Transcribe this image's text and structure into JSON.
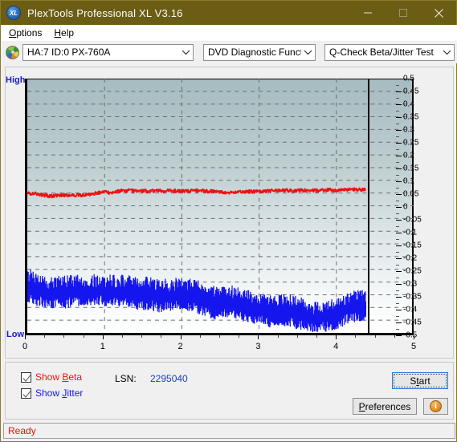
{
  "window": {
    "title": "PlexTools Professional XL V3.16",
    "icon": "XL",
    "icon_name": "plextools-logo-icon",
    "controls": {
      "minimize": "minimize-icon",
      "maximize": "maximize-icon",
      "close": "close-icon"
    },
    "titlebar_color": "#6b5d14"
  },
  "menu": {
    "items": [
      {
        "label": "Options",
        "accel": "O"
      },
      {
        "label": "Help",
        "accel": "H"
      }
    ]
  },
  "toolbar": {
    "disc_icon": "disc-icon",
    "drive": {
      "value": "HA:7 ID:0  PX-760A",
      "arrow": "chevron-down-icon"
    },
    "function": {
      "value": "DVD Diagnostic Functions",
      "arrow": "chevron-down-icon"
    },
    "test": {
      "value": "Q-Check Beta/Jitter Test",
      "arrow": "chevron-down-icon"
    }
  },
  "chart_data": {
    "type": "line",
    "title": "",
    "xlabel": "",
    "ylabel": "",
    "xlim": [
      0,
      5
    ],
    "ylim": [
      -0.5,
      0.5
    ],
    "grid": true,
    "legend": "checkboxes below plot",
    "axis_left_label": "High",
    "axis_bottom_label": "Low",
    "x_ticks": [
      0,
      1,
      2,
      3,
      4,
      5
    ],
    "y_ticks": [
      0.5,
      0.45,
      0.4,
      0.35,
      0.3,
      0.25,
      0.2,
      0.15,
      0.1,
      0.05,
      0,
      -0.05,
      -0.1,
      -0.15,
      -0.2,
      -0.25,
      -0.3,
      -0.35,
      -0.4,
      -0.45,
      -0.5
    ],
    "cursor_x": 4.38,
    "data_end_x": 4.38,
    "series": [
      {
        "name": "Beta",
        "color": "#ee1111",
        "noise": 0.006,
        "x": [
          0.0,
          0.1,
          0.2,
          0.3,
          0.4,
          0.5,
          0.6,
          0.7,
          0.8,
          0.9,
          1.0,
          1.1,
          1.2,
          1.3,
          1.4,
          1.5,
          1.6,
          1.7,
          1.8,
          1.9,
          2.0,
          2.1,
          2.2,
          2.3,
          2.4,
          2.5,
          2.6,
          2.7,
          2.8,
          2.9,
          3.0,
          3.1,
          3.2,
          3.3,
          3.4,
          3.5,
          3.6,
          3.7,
          3.8,
          3.9,
          4.0,
          4.1,
          4.2,
          4.3,
          4.38
        ],
        "y": [
          0.05,
          0.047,
          0.043,
          0.038,
          0.04,
          0.043,
          0.042,
          0.041,
          0.044,
          0.05,
          0.053,
          0.052,
          0.058,
          0.06,
          0.059,
          0.058,
          0.058,
          0.058,
          0.058,
          0.059,
          0.058,
          0.059,
          0.06,
          0.058,
          0.056,
          0.054,
          0.053,
          0.054,
          0.056,
          0.056,
          0.057,
          0.058,
          0.06,
          0.06,
          0.06,
          0.061,
          0.06,
          0.06,
          0.06,
          0.062,
          0.061,
          0.062,
          0.064,
          0.064,
          0.063
        ]
      },
      {
        "name": "Jitter",
        "color": "#1515ee",
        "band": true,
        "x": [
          0.0,
          0.1,
          0.2,
          0.3,
          0.4,
          0.5,
          0.6,
          0.7,
          0.8,
          0.9,
          1.0,
          1.1,
          1.2,
          1.3,
          1.4,
          1.5,
          1.6,
          1.7,
          1.8,
          1.9,
          2.0,
          2.1,
          2.2,
          2.3,
          2.4,
          2.5,
          2.6,
          2.7,
          2.8,
          2.9,
          3.0,
          3.1,
          3.2,
          3.3,
          3.4,
          3.5,
          3.6,
          3.7,
          3.8,
          3.9,
          4.0,
          4.1,
          4.2,
          4.3,
          4.38
        ],
        "y_top": [
          -0.27,
          -0.295,
          -0.305,
          -0.3,
          -0.305,
          -0.3,
          -0.302,
          -0.3,
          -0.298,
          -0.3,
          -0.302,
          -0.3,
          -0.302,
          -0.3,
          -0.305,
          -0.308,
          -0.31,
          -0.32,
          -0.315,
          -0.312,
          -0.31,
          -0.315,
          -0.322,
          -0.33,
          -0.345,
          -0.342,
          -0.34,
          -0.345,
          -0.355,
          -0.36,
          -0.368,
          -0.375,
          -0.378,
          -0.374,
          -0.378,
          -0.385,
          -0.398,
          -0.405,
          -0.405,
          -0.4,
          -0.392,
          -0.378,
          -0.365,
          -0.358,
          -0.362
        ],
        "y_bottom": [
          -0.355,
          -0.37,
          -0.38,
          -0.385,
          -0.38,
          -0.382,
          -0.378,
          -0.376,
          -0.37,
          -0.372,
          -0.375,
          -0.372,
          -0.376,
          -0.378,
          -0.386,
          -0.39,
          -0.392,
          -0.398,
          -0.392,
          -0.39,
          -0.388,
          -0.394,
          -0.402,
          -0.412,
          -0.426,
          -0.424,
          -0.42,
          -0.426,
          -0.436,
          -0.44,
          -0.448,
          -0.455,
          -0.458,
          -0.454,
          -0.458,
          -0.464,
          -0.472,
          -0.476,
          -0.476,
          -0.472,
          -0.466,
          -0.452,
          -0.438,
          -0.432,
          -0.436
        ]
      }
    ]
  },
  "controls": {
    "show_beta": {
      "label_prefix": "Show ",
      "label_accel": "B",
      "label_suffix": "eta",
      "checked": true,
      "color": "#ee1111"
    },
    "show_jitter": {
      "label_prefix": "Show ",
      "label_accel": "J",
      "label_suffix": "itter",
      "checked": true,
      "color": "#1515ee"
    },
    "lsn_label": "LSN:",
    "lsn_value": "2295040",
    "start_button": {
      "prefix": "S",
      "accel": "t",
      "suffix": "art",
      "focused": true
    },
    "preferences_button": {
      "accel": "P",
      "suffix": "references"
    },
    "info_button": {
      "glyph": "i",
      "name": "info-icon"
    }
  },
  "status": {
    "text": "Ready",
    "color": "#e01414"
  }
}
